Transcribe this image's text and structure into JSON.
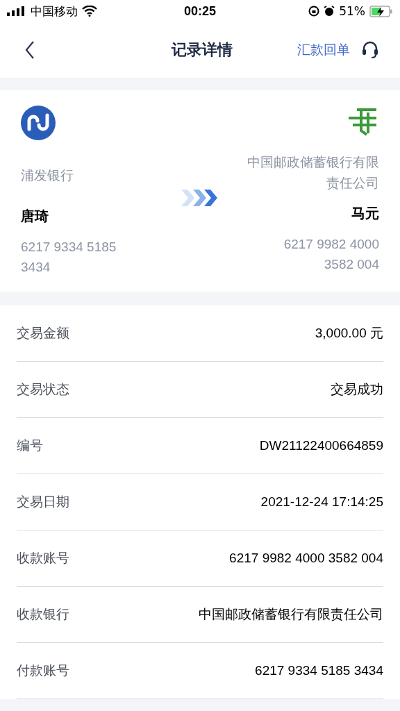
{
  "status_bar": {
    "carrier": "中国移动",
    "time": "00:25",
    "battery": "51%"
  },
  "nav": {
    "title": "记录详情",
    "action": "汇款回单"
  },
  "transfer": {
    "payer": {
      "bank": "浦发银行",
      "name": "唐琦",
      "account": "6217 9334 5185 3434"
    },
    "payee": {
      "bank": "中国邮政储蓄银行有限责任公司",
      "name": "马元",
      "account": "6217 9982 4000 3582 004"
    }
  },
  "details": [
    {
      "label": "交易金额",
      "value": "3,000.00 元"
    },
    {
      "label": "交易状态",
      "value": "交易成功"
    },
    {
      "label": "编号",
      "value": "DW21122400664859"
    },
    {
      "label": "交易日期",
      "value": "2021-12-24 17:14:25"
    },
    {
      "label": "收款账号",
      "value": "6217 9982 4000 3582 004"
    },
    {
      "label": "收款银行",
      "value": "中国邮政储蓄银行有限责任公司"
    },
    {
      "label": "付款账号",
      "value": "6217 9334 5185 3434"
    }
  ]
}
